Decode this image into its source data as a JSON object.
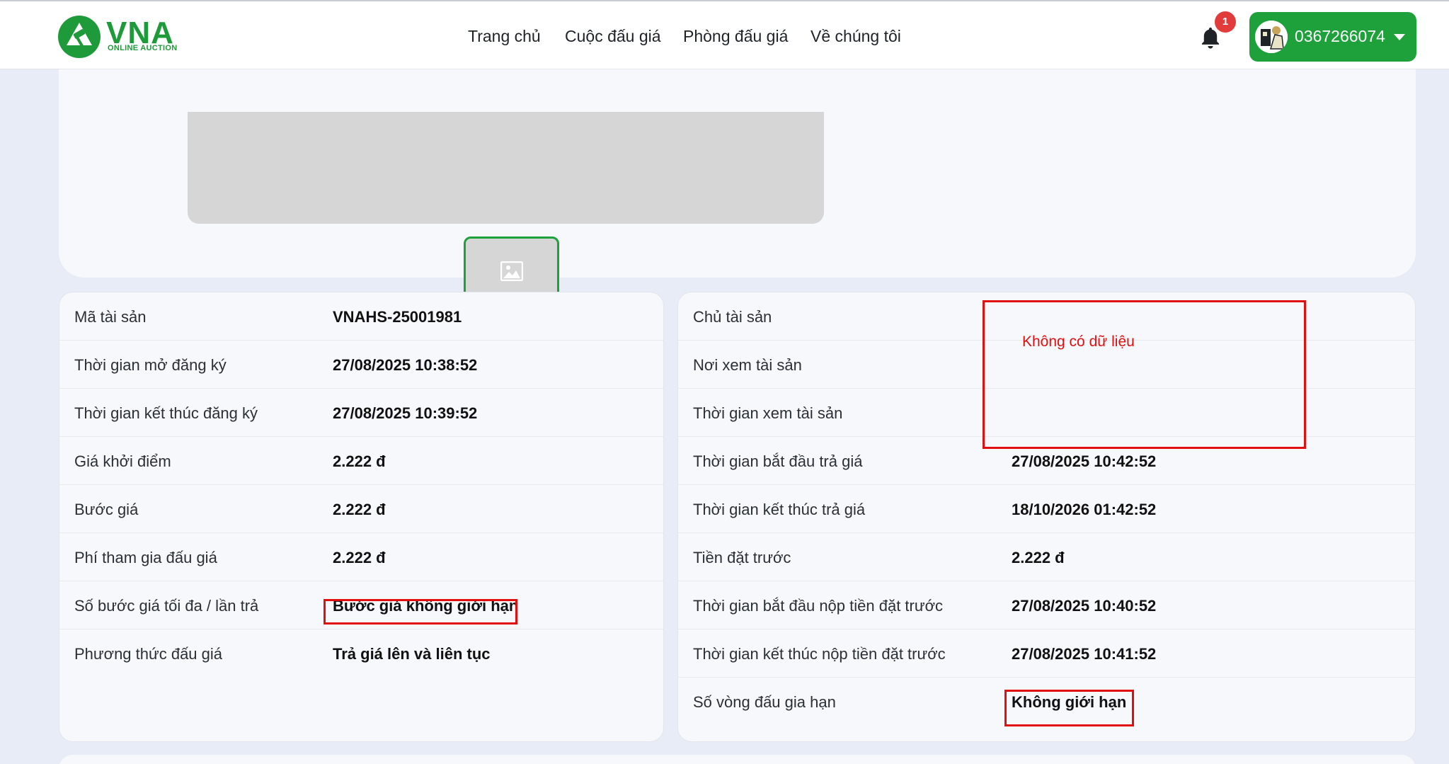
{
  "header": {
    "logo_text": "VNA",
    "logo_tagline": "ONLINE AUCTION",
    "nav": [
      {
        "label": "Trang chủ"
      },
      {
        "label": "Cuộc đấu giá"
      },
      {
        "label": "Phòng đấu giá"
      },
      {
        "label": "Về chúng tôi"
      }
    ],
    "notification_count": "1",
    "user_phone": "0367266074"
  },
  "left_details": [
    {
      "label": "Mã tài sản",
      "value": "VNAHS-25001981"
    },
    {
      "label": "Thời gian mở đăng ký",
      "value": "27/08/2025 10:38:52"
    },
    {
      "label": "Thời gian kết thúc đăng ký",
      "value": "27/08/2025 10:39:52"
    },
    {
      "label": "Giá khởi điểm",
      "value": "2.222 đ"
    },
    {
      "label": "Bước giá",
      "value": "2.222 đ"
    },
    {
      "label": "Phí tham gia đấu giá",
      "value": "2.222 đ"
    },
    {
      "label": "Số bước giá tối đa / lần trả",
      "value": "Bước giá không giới hạn"
    },
    {
      "label": "Phương thức đấu giá",
      "value": "Trả giá lên và liên tục"
    }
  ],
  "right_details": [
    {
      "label": "Chủ tài sản",
      "value": ""
    },
    {
      "label": "Nơi xem tài sản",
      "value": ""
    },
    {
      "label": "Thời gian xem tài sản",
      "value": ""
    },
    {
      "label": "Thời gian bắt đầu trả giá",
      "value": "27/08/2025 10:42:52"
    },
    {
      "label": "Thời gian kết thúc trả giá",
      "value": "18/10/2026 01:42:52"
    },
    {
      "label": "Tiền đặt trước",
      "value": "2.222 đ"
    },
    {
      "label": "Thời gian bắt đầu nộp tiền đặt trước",
      "value": "27/08/2025 10:40:52"
    },
    {
      "label": "Thời gian kết thúc nộp tiền đặt trước",
      "value": "27/08/2025 10:41:52"
    },
    {
      "label": "Số vòng đấu gia hạn",
      "value": "Không giới hạn"
    }
  ],
  "annotation": {
    "no_data_text": "Không có dữ liệu"
  },
  "colors": {
    "brand_green": "#1ea13b",
    "highlight_red": "#e01010",
    "page_bg": "#e8ecf6"
  },
  "icons": [
    "bell-icon",
    "image-placeholder-icon",
    "chevron-down-icon",
    "logo-hammer-icon"
  ]
}
